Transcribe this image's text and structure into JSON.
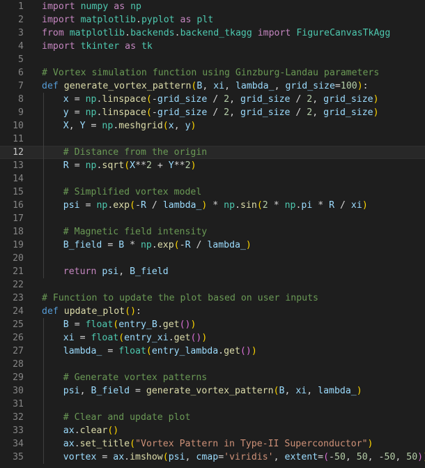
{
  "editor": {
    "language": "python",
    "active_line": 12,
    "colors": {
      "background": "#1e1e1e",
      "keyword": "#c586c0",
      "def": "#569cd6",
      "function": "#dcdcaa",
      "variable": "#9cdcfe",
      "number": "#b5cea8",
      "string": "#ce9178",
      "comment": "#6a9955",
      "class": "#4ec9b0"
    },
    "lines": [
      {
        "n": "1",
        "indent": 0,
        "tokens": [
          [
            "kw",
            "import"
          ],
          [
            "pl",
            " "
          ],
          [
            "cls",
            "numpy"
          ],
          [
            "pl",
            " "
          ],
          [
            "kw",
            "as"
          ],
          [
            "pl",
            " "
          ],
          [
            "cls",
            "np"
          ]
        ]
      },
      {
        "n": "2",
        "indent": 0,
        "tokens": [
          [
            "kw",
            "import"
          ],
          [
            "pl",
            " "
          ],
          [
            "cls",
            "matplotlib"
          ],
          [
            "pl",
            "."
          ],
          [
            "cls",
            "pyplot"
          ],
          [
            "pl",
            " "
          ],
          [
            "kw",
            "as"
          ],
          [
            "pl",
            " "
          ],
          [
            "cls",
            "plt"
          ]
        ]
      },
      {
        "n": "3",
        "indent": 0,
        "tokens": [
          [
            "kw",
            "from"
          ],
          [
            "pl",
            " "
          ],
          [
            "cls",
            "matplotlib"
          ],
          [
            "pl",
            "."
          ],
          [
            "cls",
            "backends"
          ],
          [
            "pl",
            "."
          ],
          [
            "cls",
            "backend_tkagg"
          ],
          [
            "pl",
            " "
          ],
          [
            "kw",
            "import"
          ],
          [
            "pl",
            " "
          ],
          [
            "cls",
            "FigureCanvasTkAgg"
          ]
        ]
      },
      {
        "n": "4",
        "indent": 0,
        "tokens": [
          [
            "kw",
            "import"
          ],
          [
            "pl",
            " "
          ],
          [
            "cls",
            "tkinter"
          ],
          [
            "pl",
            " "
          ],
          [
            "kw",
            "as"
          ],
          [
            "pl",
            " "
          ],
          [
            "cls",
            "tk"
          ]
        ]
      },
      {
        "n": "5",
        "indent": 0,
        "tokens": []
      },
      {
        "n": "6",
        "indent": 0,
        "tokens": [
          [
            "com",
            "# Vortex simulation function using Ginzburg-Landau parameters"
          ]
        ]
      },
      {
        "n": "7",
        "indent": 0,
        "tokens": [
          [
            "def",
            "def"
          ],
          [
            "pl",
            " "
          ],
          [
            "fn",
            "generate_vortex_pattern"
          ],
          [
            "br1",
            "("
          ],
          [
            "var",
            "B"
          ],
          [
            "pl",
            ", "
          ],
          [
            "var",
            "xi"
          ],
          [
            "pl",
            ", "
          ],
          [
            "var",
            "lambda_"
          ],
          [
            "pl",
            ", "
          ],
          [
            "var",
            "grid_size"
          ],
          [
            "pl",
            "="
          ],
          [
            "num",
            "100"
          ],
          [
            "br1",
            ")"
          ],
          [
            "pl",
            ":"
          ]
        ]
      },
      {
        "n": "8",
        "indent": 1,
        "tokens": [
          [
            "var",
            "x"
          ],
          [
            "pl",
            " = "
          ],
          [
            "cls",
            "np"
          ],
          [
            "pl",
            "."
          ],
          [
            "fn",
            "linspace"
          ],
          [
            "br1",
            "("
          ],
          [
            "pl",
            "-"
          ],
          [
            "var",
            "grid_size"
          ],
          [
            "pl",
            " / "
          ],
          [
            "num",
            "2"
          ],
          [
            "pl",
            ", "
          ],
          [
            "var",
            "grid_size"
          ],
          [
            "pl",
            " / "
          ],
          [
            "num",
            "2"
          ],
          [
            "pl",
            ", "
          ],
          [
            "var",
            "grid_size"
          ],
          [
            "br1",
            ")"
          ]
        ]
      },
      {
        "n": "9",
        "indent": 1,
        "tokens": [
          [
            "var",
            "y"
          ],
          [
            "pl",
            " = "
          ],
          [
            "cls",
            "np"
          ],
          [
            "pl",
            "."
          ],
          [
            "fn",
            "linspace"
          ],
          [
            "br1",
            "("
          ],
          [
            "pl",
            "-"
          ],
          [
            "var",
            "grid_size"
          ],
          [
            "pl",
            " / "
          ],
          [
            "num",
            "2"
          ],
          [
            "pl",
            ", "
          ],
          [
            "var",
            "grid_size"
          ],
          [
            "pl",
            " / "
          ],
          [
            "num",
            "2"
          ],
          [
            "pl",
            ", "
          ],
          [
            "var",
            "grid_size"
          ],
          [
            "br1",
            ")"
          ]
        ]
      },
      {
        "n": "10",
        "indent": 1,
        "tokens": [
          [
            "var",
            "X"
          ],
          [
            "pl",
            ", "
          ],
          [
            "var",
            "Y"
          ],
          [
            "pl",
            " = "
          ],
          [
            "cls",
            "np"
          ],
          [
            "pl",
            "."
          ],
          [
            "fn",
            "meshgrid"
          ],
          [
            "br1",
            "("
          ],
          [
            "var",
            "x"
          ],
          [
            "pl",
            ", "
          ],
          [
            "var",
            "y"
          ],
          [
            "br1",
            ")"
          ]
        ]
      },
      {
        "n": "11",
        "indent": 1,
        "tokens": []
      },
      {
        "n": "12",
        "indent": 1,
        "tokens": [
          [
            "com",
            "# Distance from the origin"
          ]
        ]
      },
      {
        "n": "13",
        "indent": 1,
        "tokens": [
          [
            "var",
            "R"
          ],
          [
            "pl",
            " = "
          ],
          [
            "cls",
            "np"
          ],
          [
            "pl",
            "."
          ],
          [
            "fn",
            "sqrt"
          ],
          [
            "br1",
            "("
          ],
          [
            "var",
            "X"
          ],
          [
            "pl",
            "**"
          ],
          [
            "num",
            "2"
          ],
          [
            "pl",
            " + "
          ],
          [
            "var",
            "Y"
          ],
          [
            "pl",
            "**"
          ],
          [
            "num",
            "2"
          ],
          [
            "br1",
            ")"
          ]
        ]
      },
      {
        "n": "14",
        "indent": 1,
        "tokens": []
      },
      {
        "n": "15",
        "indent": 1,
        "tokens": [
          [
            "com",
            "# Simplified vortex model"
          ]
        ]
      },
      {
        "n": "16",
        "indent": 1,
        "tokens": [
          [
            "var",
            "psi"
          ],
          [
            "pl",
            " = "
          ],
          [
            "cls",
            "np"
          ],
          [
            "pl",
            "."
          ],
          [
            "fn",
            "exp"
          ],
          [
            "br1",
            "("
          ],
          [
            "pl",
            "-"
          ],
          [
            "var",
            "R"
          ],
          [
            "pl",
            " / "
          ],
          [
            "var",
            "lambda_"
          ],
          [
            "br1",
            ")"
          ],
          [
            "pl",
            " * "
          ],
          [
            "cls",
            "np"
          ],
          [
            "pl",
            "."
          ],
          [
            "fn",
            "sin"
          ],
          [
            "br1",
            "("
          ],
          [
            "num",
            "2"
          ],
          [
            "pl",
            " * "
          ],
          [
            "cls",
            "np"
          ],
          [
            "pl",
            "."
          ],
          [
            "var",
            "pi"
          ],
          [
            "pl",
            " * "
          ],
          [
            "var",
            "R"
          ],
          [
            "pl",
            " / "
          ],
          [
            "var",
            "xi"
          ],
          [
            "br1",
            ")"
          ]
        ]
      },
      {
        "n": "17",
        "indent": 1,
        "tokens": []
      },
      {
        "n": "18",
        "indent": 1,
        "tokens": [
          [
            "com",
            "# Magnetic field intensity"
          ]
        ]
      },
      {
        "n": "19",
        "indent": 1,
        "tokens": [
          [
            "var",
            "B_field"
          ],
          [
            "pl",
            " = "
          ],
          [
            "var",
            "B"
          ],
          [
            "pl",
            " * "
          ],
          [
            "cls",
            "np"
          ],
          [
            "pl",
            "."
          ],
          [
            "fn",
            "exp"
          ],
          [
            "br1",
            "("
          ],
          [
            "pl",
            "-"
          ],
          [
            "var",
            "R"
          ],
          [
            "pl",
            " / "
          ],
          [
            "var",
            "lambda_"
          ],
          [
            "br1",
            ")"
          ]
        ]
      },
      {
        "n": "20",
        "indent": 1,
        "tokens": []
      },
      {
        "n": "21",
        "indent": 1,
        "tokens": [
          [
            "kw",
            "return"
          ],
          [
            "pl",
            " "
          ],
          [
            "var",
            "psi"
          ],
          [
            "pl",
            ", "
          ],
          [
            "var",
            "B_field"
          ]
        ]
      },
      {
        "n": "22",
        "indent": 0,
        "tokens": []
      },
      {
        "n": "23",
        "indent": 0,
        "tokens": [
          [
            "com",
            "# Function to update the plot based on user inputs"
          ]
        ]
      },
      {
        "n": "24",
        "indent": 0,
        "tokens": [
          [
            "def",
            "def"
          ],
          [
            "pl",
            " "
          ],
          [
            "fn",
            "update_plot"
          ],
          [
            "br1",
            "()"
          ],
          [
            "pl",
            ":"
          ]
        ]
      },
      {
        "n": "25",
        "indent": 1,
        "tokens": [
          [
            "var",
            "B"
          ],
          [
            "pl",
            " = "
          ],
          [
            "cls",
            "float"
          ],
          [
            "br1",
            "("
          ],
          [
            "var",
            "entry_B"
          ],
          [
            "pl",
            "."
          ],
          [
            "fn",
            "get"
          ],
          [
            "br2",
            "()"
          ],
          [
            "br1",
            ")"
          ]
        ]
      },
      {
        "n": "26",
        "indent": 1,
        "tokens": [
          [
            "var",
            "xi"
          ],
          [
            "pl",
            " = "
          ],
          [
            "cls",
            "float"
          ],
          [
            "br1",
            "("
          ],
          [
            "var",
            "entry_xi"
          ],
          [
            "pl",
            "."
          ],
          [
            "fn",
            "get"
          ],
          [
            "br2",
            "()"
          ],
          [
            "br1",
            ")"
          ]
        ]
      },
      {
        "n": "27",
        "indent": 1,
        "tokens": [
          [
            "var",
            "lambda_"
          ],
          [
            "pl",
            " = "
          ],
          [
            "cls",
            "float"
          ],
          [
            "br1",
            "("
          ],
          [
            "var",
            "entry_lambda"
          ],
          [
            "pl",
            "."
          ],
          [
            "fn",
            "get"
          ],
          [
            "br2",
            "()"
          ],
          [
            "br1",
            ")"
          ]
        ]
      },
      {
        "n": "28",
        "indent": 1,
        "tokens": []
      },
      {
        "n": "29",
        "indent": 1,
        "tokens": [
          [
            "com",
            "# Generate vortex patterns"
          ]
        ]
      },
      {
        "n": "30",
        "indent": 1,
        "tokens": [
          [
            "var",
            "psi"
          ],
          [
            "pl",
            ", "
          ],
          [
            "var",
            "B_field"
          ],
          [
            "pl",
            " = "
          ],
          [
            "fn",
            "generate_vortex_pattern"
          ],
          [
            "br1",
            "("
          ],
          [
            "var",
            "B"
          ],
          [
            "pl",
            ", "
          ],
          [
            "var",
            "xi"
          ],
          [
            "pl",
            ", "
          ],
          [
            "var",
            "lambda_"
          ],
          [
            "br1",
            ")"
          ]
        ]
      },
      {
        "n": "31",
        "indent": 1,
        "tokens": []
      },
      {
        "n": "32",
        "indent": 1,
        "tokens": [
          [
            "com",
            "# Clear and update plot"
          ]
        ]
      },
      {
        "n": "33",
        "indent": 1,
        "tokens": [
          [
            "var",
            "ax"
          ],
          [
            "pl",
            "."
          ],
          [
            "fn",
            "clear"
          ],
          [
            "br1",
            "()"
          ]
        ]
      },
      {
        "n": "34",
        "indent": 1,
        "tokens": [
          [
            "var",
            "ax"
          ],
          [
            "pl",
            "."
          ],
          [
            "fn",
            "set_title"
          ],
          [
            "br1",
            "("
          ],
          [
            "str",
            "\"Vortex Pattern in Type-II Superconductor\""
          ],
          [
            "br1",
            ")"
          ]
        ]
      },
      {
        "n": "35",
        "indent": 1,
        "tokens": [
          [
            "var",
            "vortex"
          ],
          [
            "pl",
            " = "
          ],
          [
            "var",
            "ax"
          ],
          [
            "pl",
            "."
          ],
          [
            "fn",
            "imshow"
          ],
          [
            "br1",
            "("
          ],
          [
            "var",
            "psi"
          ],
          [
            "pl",
            ", "
          ],
          [
            "var",
            "cmap"
          ],
          [
            "pl",
            "="
          ],
          [
            "str",
            "'viridis'"
          ],
          [
            "pl",
            ", "
          ],
          [
            "var",
            "extent"
          ],
          [
            "pl",
            "="
          ],
          [
            "br2",
            "("
          ],
          [
            "pl",
            "-"
          ],
          [
            "num",
            "50"
          ],
          [
            "pl",
            ", "
          ],
          [
            "num",
            "50"
          ],
          [
            "pl",
            ", -"
          ],
          [
            "num",
            "50"
          ],
          [
            "pl",
            ", "
          ],
          [
            "num",
            "50"
          ],
          [
            "br2",
            ")"
          ],
          [
            "br1",
            ")"
          ]
        ]
      }
    ]
  }
}
